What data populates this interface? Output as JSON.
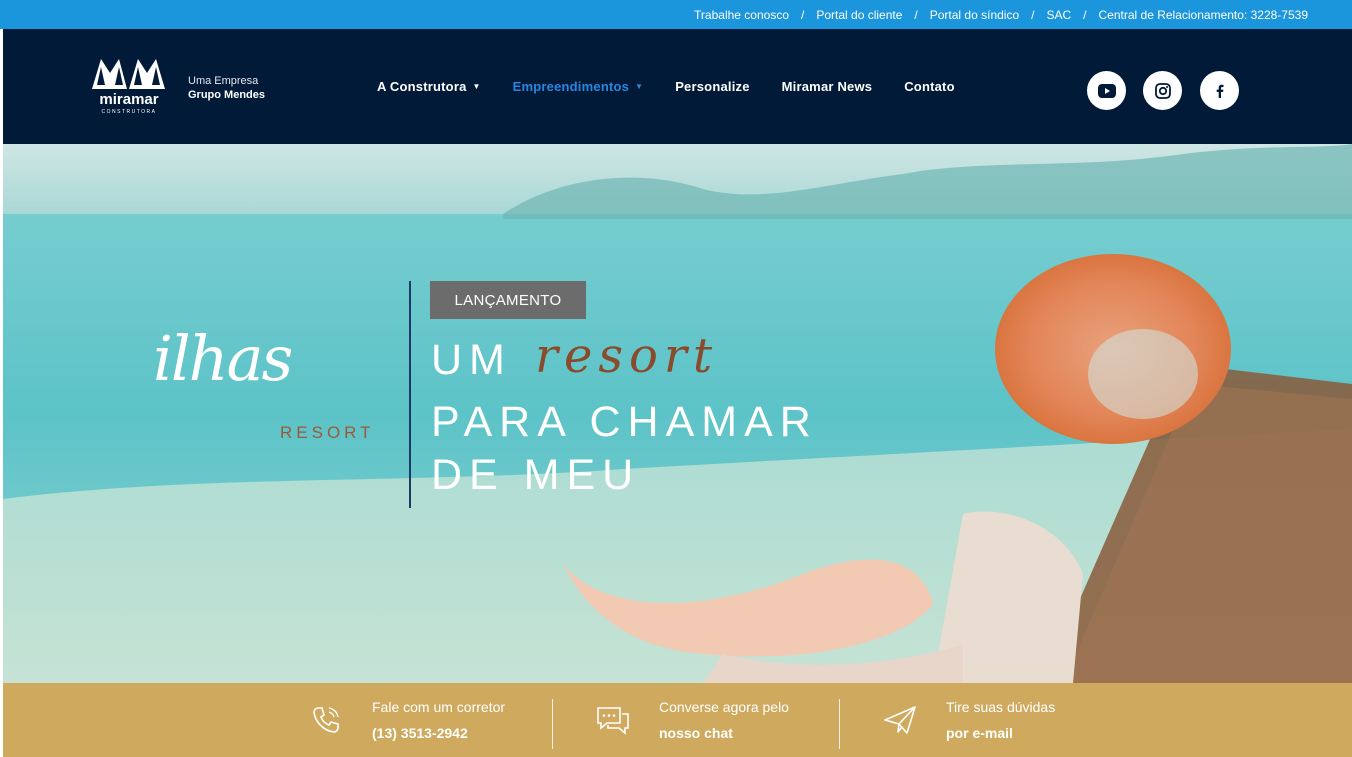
{
  "topbar": {
    "links": [
      "Trabalhe conosco",
      "Portal do cliente",
      "Portal do síndico",
      "SAC",
      "Central de Relacionamento: 3228-7539"
    ],
    "separator": "/"
  },
  "header": {
    "logo": {
      "brand": "miramar",
      "sub": "CONSTRUTORA"
    },
    "tagline_1": "Uma Empresa",
    "tagline_2": "Grupo Mendes",
    "nav": [
      {
        "label": "A Construtora",
        "has_dropdown": true,
        "active": false
      },
      {
        "label": "Empreendimentos",
        "has_dropdown": true,
        "active": true
      },
      {
        "label": "Personalize",
        "has_dropdown": false,
        "active": false
      },
      {
        "label": "Miramar News",
        "has_dropdown": false,
        "active": false
      },
      {
        "label": "Contato",
        "has_dropdown": false,
        "active": false
      }
    ],
    "social": [
      "youtube-icon",
      "instagram-icon",
      "facebook-icon"
    ]
  },
  "hero": {
    "badge": "LANÇAMENTO",
    "script_logo": "ilhas",
    "logo_sub": "RESORT",
    "headline_1": "UM",
    "headline_script": "resort",
    "headline_2": "PARA CHAMAR",
    "headline_3": "DE MEU"
  },
  "contact": [
    {
      "icon": "phone-icon",
      "line1": "Fale com um corretor",
      "line2": "(13) 3513-2942"
    },
    {
      "icon": "chat-icon",
      "line1": "Converse agora pelo",
      "line2": "nosso chat"
    },
    {
      "icon": "send-icon",
      "line1": "Tire suas dúvidas",
      "line2": "por e-mail"
    }
  ],
  "colors": {
    "topbar": "#1b95dc",
    "header": "#001a38",
    "nav_active": "#2a86e0",
    "contactbar": "#cfaa5e",
    "accent_script": "#8a4a2c"
  }
}
